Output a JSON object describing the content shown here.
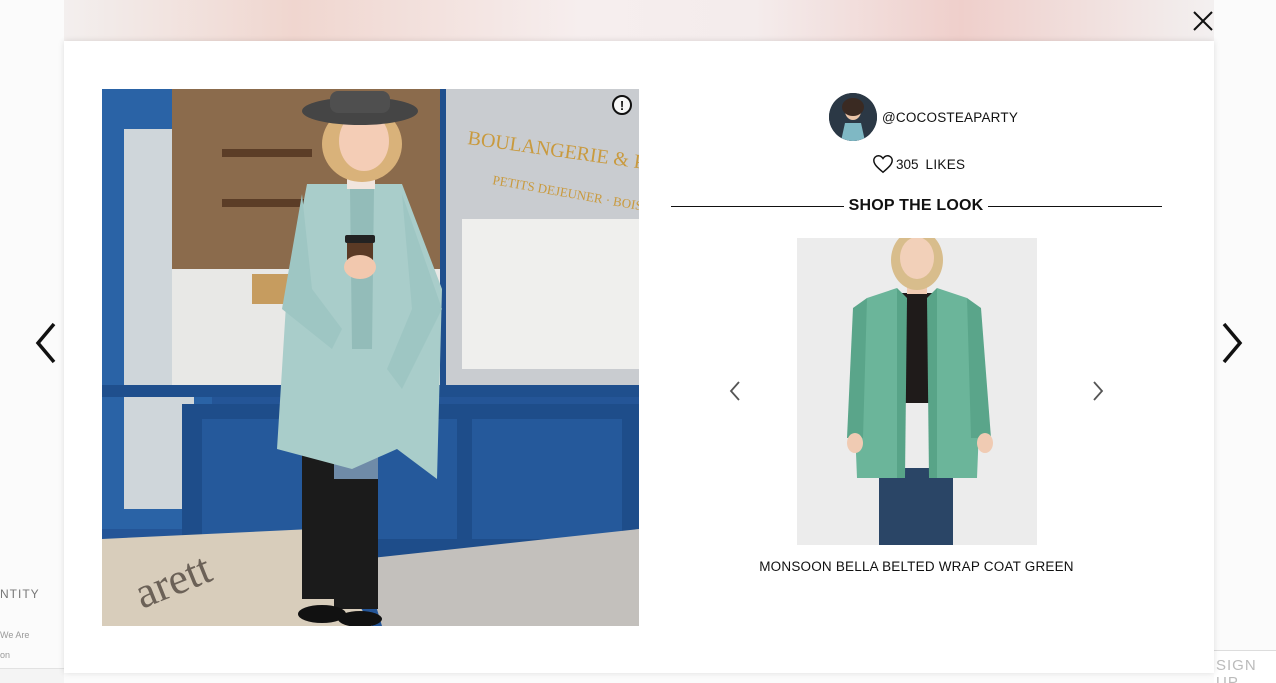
{
  "background": {
    "left_heading": "NTITY",
    "left_small_1": "We Are",
    "left_small_2": "on",
    "signup_label": "SIGN UP"
  },
  "modal": {
    "username": "@COCOSTEAPARTY",
    "likes_count": "305",
    "likes_label": "LIKES",
    "shop_title": "SHOP THE LOOK",
    "product_name": "MONSOON BELLA BELTED WRAP COAT GREEN",
    "report_label": "!"
  },
  "icons": {
    "prev": "chevron-left-icon",
    "next": "chevron-right-icon",
    "close": "close-icon",
    "heart": "heart-icon",
    "report": "exclamation-circle-icon"
  },
  "colors": {
    "coat": "#a9cdca",
    "product_coat": "#6bb59a",
    "shop_blue": "#1f4f8d"
  }
}
